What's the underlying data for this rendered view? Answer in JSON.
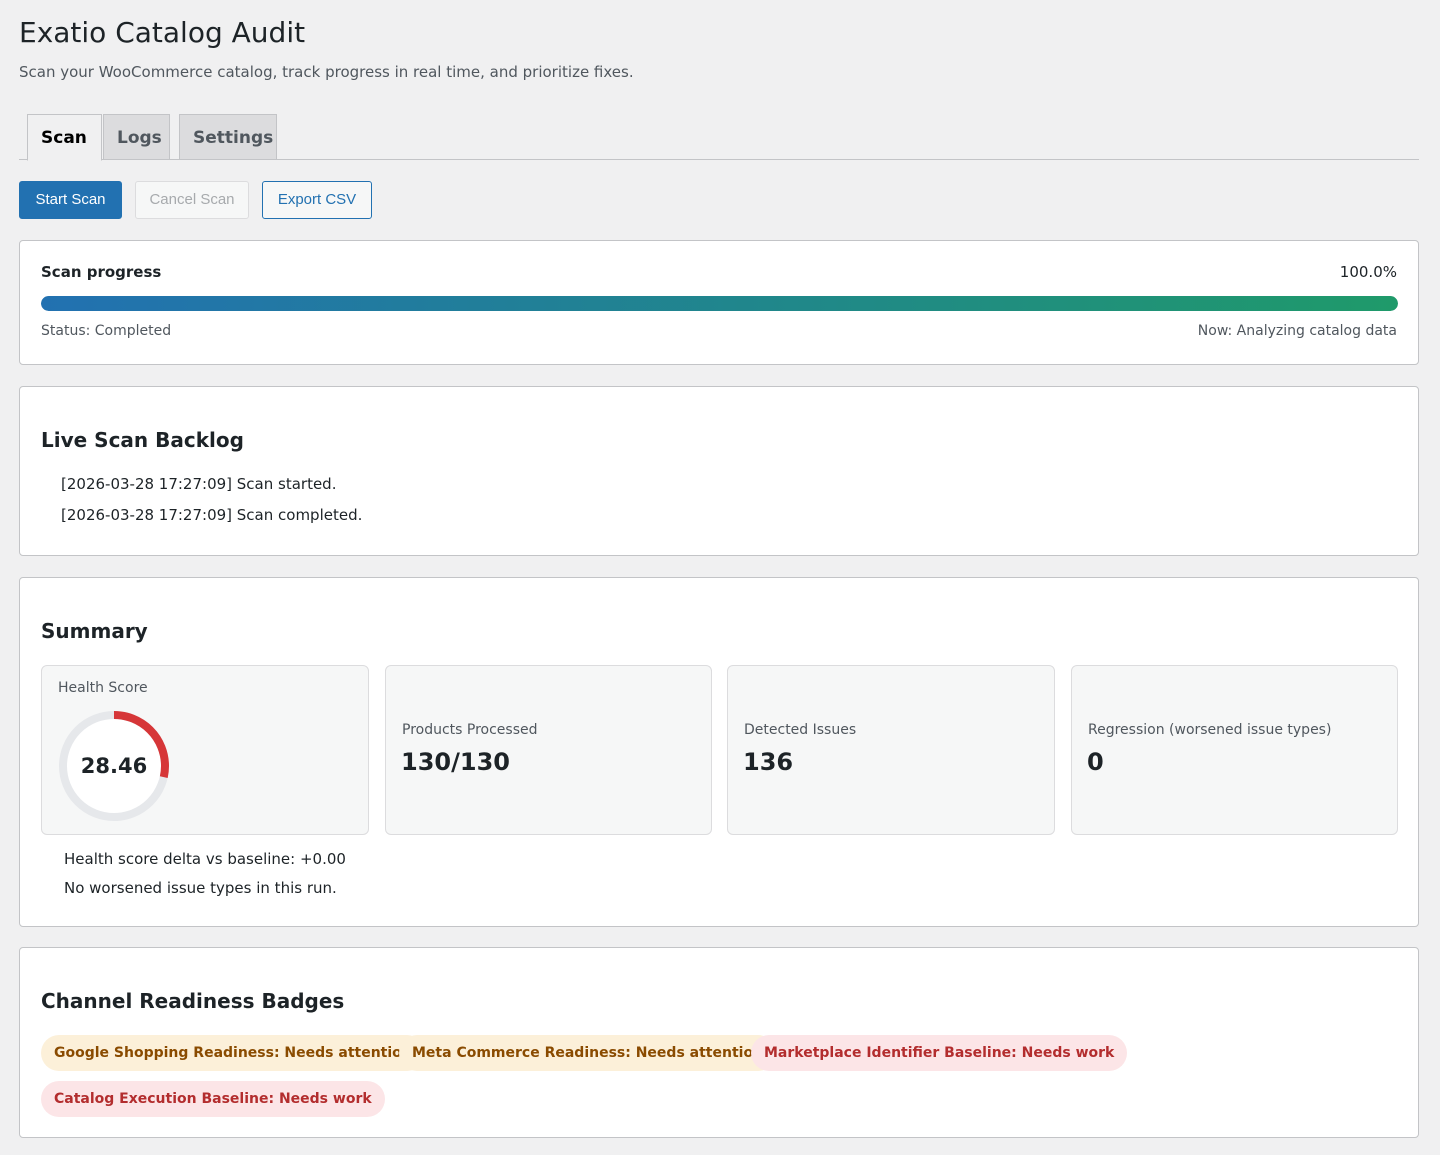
{
  "header": {
    "title": "Exatio Catalog Audit",
    "subtitle": "Scan your WooCommerce catalog, track progress in real time, and prioritize fixes."
  },
  "tabs": [
    {
      "label": "Scan",
      "active": true
    },
    {
      "label": "Logs",
      "active": false
    },
    {
      "label": "Settings",
      "active": false
    }
  ],
  "actions": {
    "start_scan": "Start Scan",
    "cancel_scan": "Cancel Scan",
    "export_csv": "Export CSV"
  },
  "progress": {
    "label": "Scan progress",
    "percent_text": "100.0%",
    "percent": 100,
    "status": "Status: Completed",
    "now": "Now: Analyzing catalog data"
  },
  "backlog": {
    "title": "Live Scan Backlog",
    "entries": [
      "[2026-03-28 17:27:09] Scan started.",
      "[2026-03-28 17:27:09] Scan completed."
    ]
  },
  "summary": {
    "title": "Summary",
    "health": {
      "label": "Health Score",
      "value": "28.46",
      "fraction": 0.2846,
      "color": "#d63638"
    },
    "products": {
      "label": "Products Processed",
      "value": "130/130"
    },
    "issues": {
      "label": "Detected Issues",
      "value": "136"
    },
    "regression": {
      "label": "Regression (worsened issue types)",
      "value": "0"
    },
    "delta_note": "Health score delta vs baseline: +0.00",
    "worsened_note": "No worsened issue types in this run."
  },
  "badges": {
    "title": "Channel Readiness Badges",
    "items": [
      {
        "label": "Google Shopping Readiness: Needs attention",
        "status": "warn"
      },
      {
        "label": "Meta Commerce Readiness: Needs attention",
        "status": "warn"
      },
      {
        "label": "Marketplace Identifier Baseline: Needs work",
        "status": "bad"
      },
      {
        "label": "Catalog Execution Baseline: Needs work",
        "status": "bad"
      }
    ]
  },
  "colors": {
    "primary": "#2271b1",
    "progress_end": "#1f9a6a",
    "warn_bg": "#fcf0d9",
    "warn_text": "#8a4b00",
    "bad_bg": "#fce5e7",
    "bad_text": "#b32d2e"
  }
}
